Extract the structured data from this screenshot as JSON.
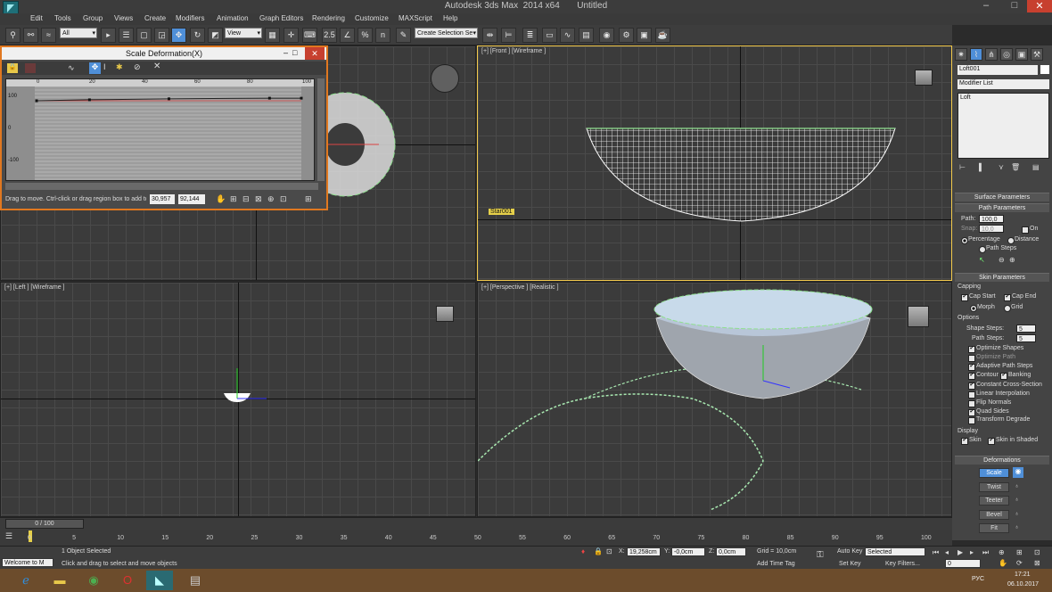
{
  "window": {
    "title": "Autodesk 3ds Max  2014 x64       Untitled"
  },
  "menu": [
    "Edit",
    "Tools",
    "Group",
    "Views",
    "Create",
    "Modifiers",
    "Animation",
    "Graph Editors",
    "Rendering",
    "Customize",
    "MAXScript",
    "Help"
  ],
  "toolbar": {
    "selection_filter": "All",
    "ref_coord": "View",
    "named_selection": "Create Selection Se",
    "snap_label": "2.5",
    "pct_label": "%",
    "angle_label": "n"
  },
  "scale_window": {
    "title": "Scale Deformation(X)",
    "ruler_ticks": [
      "0",
      "20",
      "40",
      "60",
      "80",
      "100"
    ],
    "y_ticks": [
      "100",
      "0",
      "-100"
    ],
    "status": "Drag to move. Ctrl-click or drag region box to add to",
    "coord_x": "30,957",
    "coord_y": "92,144",
    "curve_points": [
      [
        0,
        100
      ],
      [
        20,
        103
      ],
      [
        50,
        106
      ],
      [
        88,
        108
      ],
      [
        100,
        108
      ]
    ]
  },
  "viewports": {
    "top_label": "",
    "front_label": "[+] [Front ] [Wireframe ]",
    "front_object": "Star001",
    "left_label": "[+] [Left ] [Wireframe ]",
    "persp_label": "[+] [Perspective ] [Realistic ]"
  },
  "cmd_panel": {
    "object_name": "Loft001",
    "modifier_list": "Modifier List",
    "stack_item": "Loft",
    "rollouts": {
      "surface": "Surface Parameters",
      "path": "Path Parameters",
      "skin": "Skin Parameters",
      "deform": "Deformations"
    },
    "path": {
      "path_label": "Path:",
      "path_value": "100,0",
      "snap_label": "Snap:",
      "snap_value": "10,0",
      "on_label": "On",
      "percentage": "Percentage",
      "distance": "Distance",
      "path_steps": "Path Steps"
    },
    "capping": {
      "title": "Capping",
      "cap_start": "Cap Start",
      "cap_end": "Cap End",
      "morph": "Morph",
      "grid": "Grid"
    },
    "options": {
      "title": "Options",
      "shape_steps_label": "Shape Steps:",
      "shape_steps": "5",
      "path_steps_label": "Path Steps:",
      "path_steps": "5",
      "optimize_shapes": "Optimize Shapes",
      "optimize_path": "Optimize Path",
      "adaptive": "Adaptive Path Steps",
      "contour": "Contour",
      "banking": "Banking",
      "constant": "Constant Cross-Section",
      "linear": "Linear Interpolation",
      "flip": "Flip Normals",
      "quad": "Quad Sides",
      "transform": "Transform Degrade"
    },
    "display": {
      "title": "Display",
      "skin": "Skin",
      "skin_shaded": "Skin in Shaded"
    },
    "deformations": [
      "Scale",
      "Twist",
      "Teeter",
      "Bevel",
      "Fit"
    ]
  },
  "timeline": {
    "frame_label": "0 / 100",
    "ticks": [
      "0",
      "5",
      "10",
      "15",
      "20",
      "25",
      "30",
      "35",
      "40",
      "45",
      "50",
      "55",
      "60",
      "65",
      "70",
      "75",
      "80",
      "85",
      "90",
      "95",
      "100"
    ]
  },
  "status": {
    "maxscript": "Welcome to M",
    "selection": "1 Object Selected",
    "prompt": "Click and drag to select and move objects",
    "x_label": "X:",
    "x_value": "19,258cm",
    "y_label": "Y:",
    "y_value": "-0,0cm",
    "z_label": "Z:",
    "z_value": "0,0cm",
    "grid": "Grid = 10,0cm",
    "add_time_tag": "Add Time Tag",
    "auto_key": "Auto Key",
    "set_key": "Set Key",
    "selected_dd": "Selected",
    "key_filters": "Key Filters...",
    "frame_value": "0"
  },
  "taskbar": {
    "lang": "РУС",
    "time": "17:21",
    "date": "06.10.2017"
  }
}
